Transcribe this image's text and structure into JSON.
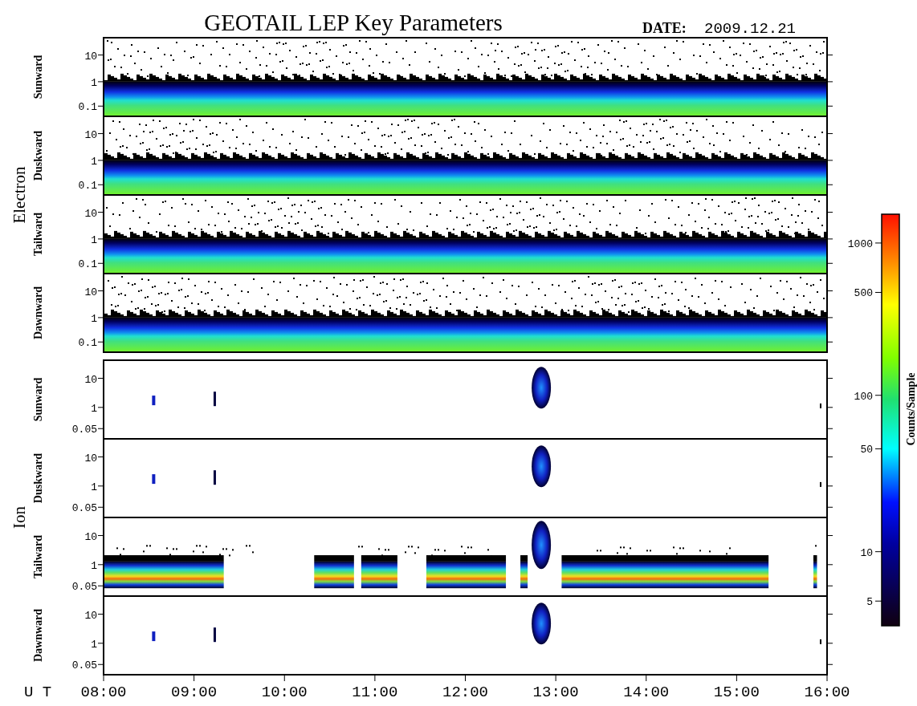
{
  "title": "GEOTAIL LEP Key Parameters",
  "date_label": "DATE:",
  "date": "2009.12.21",
  "groups": [
    {
      "label": "Electron",
      "kind": "electron",
      "panels": [
        {
          "label": "Sunward",
          "kind": "band",
          "yticks": [
            "10",
            "1",
            "0.1"
          ]
        },
        {
          "label": "Duskward",
          "kind": "band",
          "yticks": [
            "10",
            "1",
            "0.1"
          ]
        },
        {
          "label": "Tailward",
          "kind": "band",
          "yticks": [
            "10",
            "1",
            "0.1"
          ]
        },
        {
          "label": "Dawnward",
          "kind": "band",
          "yticks": [
            "10",
            "1",
            "0.1"
          ]
        }
      ]
    },
    {
      "label": "Ion",
      "kind": "ion",
      "panels": [
        {
          "label": "Sunward",
          "kind": "sparse",
          "yticks": [
            "10",
            "1",
            "0.05"
          ]
        },
        {
          "label": "Duskward",
          "kind": "sparse",
          "yticks": [
            "10",
            "1",
            "0.05"
          ]
        },
        {
          "label": "Tailward",
          "kind": "gapped",
          "yticks": [
            "10",
            "1",
            "0.05"
          ]
        },
        {
          "label": "Dawnward",
          "kind": "sparse",
          "yticks": [
            "10",
            "1",
            "0.05"
          ]
        }
      ]
    }
  ],
  "time_axis": {
    "label": "U T",
    "ticks": [
      "08:00",
      "09:00",
      "10:00",
      "11:00",
      "12:00",
      "13:00",
      "14:00",
      "15:00",
      "16:00"
    ]
  },
  "colorbar": {
    "title": "Counts/Sample",
    "ticks": [
      "1000",
      "500",
      "100",
      "50",
      "10",
      "5"
    ]
  }
}
